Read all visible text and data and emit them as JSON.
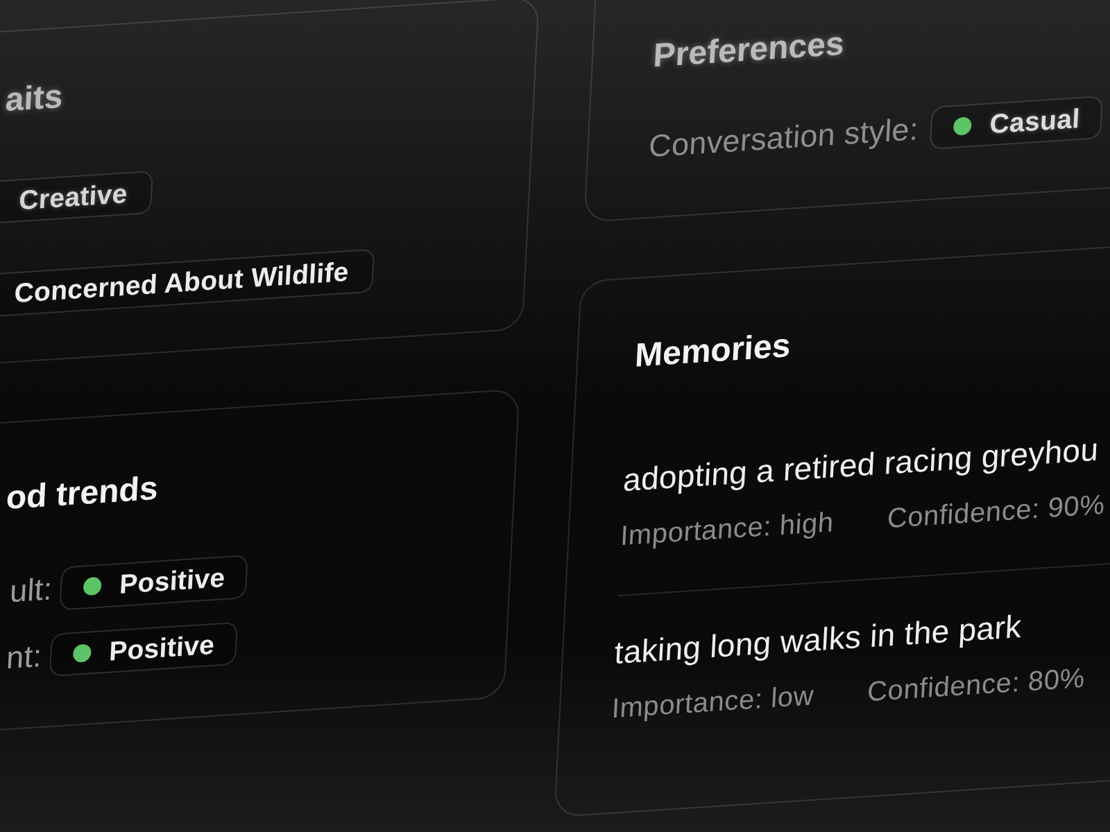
{
  "traits_card": {
    "title": "aits",
    "tags": [
      "Creative",
      "Concerned About Wildlife"
    ]
  },
  "mood_card": {
    "title": "od trends",
    "rows": [
      {
        "label": "ult:",
        "value": "Positive",
        "color": "#5cc466"
      },
      {
        "label": "nt:",
        "value": "Positive",
        "color": "#5cc466"
      }
    ]
  },
  "preferences_card": {
    "title": "Preferences",
    "rows": [
      {
        "label": "Conversation style:",
        "value": "Casual",
        "color": "#5cc466"
      }
    ]
  },
  "memories_card": {
    "title": "Memories",
    "items": [
      {
        "text": "adopting a retired racing greyhou",
        "importance": "Importance: high",
        "confidence": "Confidence: 90%"
      },
      {
        "text": "taking long walks in the park",
        "importance": "Importance: low",
        "confidence": "Confidence: 80%"
      }
    ]
  }
}
